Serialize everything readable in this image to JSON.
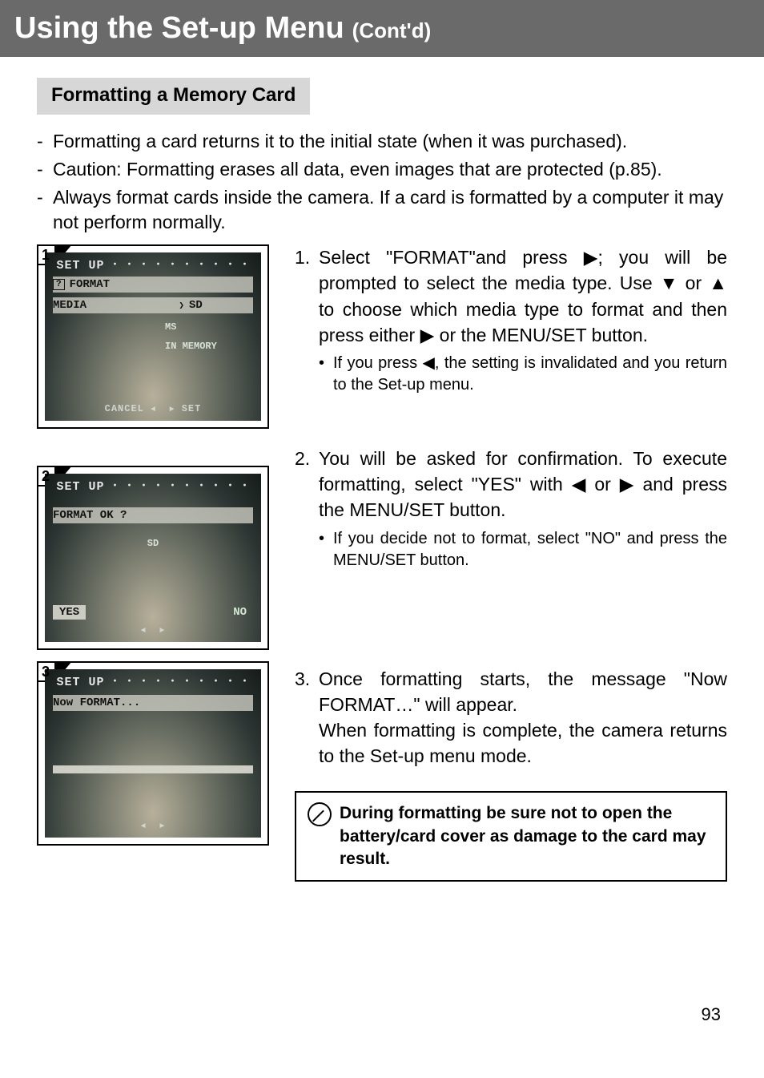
{
  "header": {
    "title": "Using the Set-up Menu",
    "subtitle": "(Cont'd)"
  },
  "section": {
    "heading": "Formatting a Memory Card"
  },
  "intro": {
    "items": [
      "Formatting a card returns it to the initial state (when it was purchased).",
      "Caution: Formatting erases all data, even images that are protected (p.85).",
      "Always format cards inside the camera.  If a card is formatted by a computer it may not perform normally."
    ]
  },
  "screenshots": {
    "s1": {
      "num": "1",
      "title": "SET UP",
      "row_format": "FORMAT",
      "row_media": "MEDIA",
      "opt_sd": "SD",
      "opt_ms": "MS",
      "opt_mem": "IN MEMORY",
      "foot_cancel": "CANCEL",
      "foot_set": "SET"
    },
    "s2": {
      "num": "2",
      "title": "SET UP",
      "row_prompt": "FORMAT OK ?",
      "opt_sd": "SD",
      "yes": "YES",
      "no": "NO"
    },
    "s3": {
      "num": "3",
      "title": "SET UP",
      "row_status": "Now FORMAT..."
    }
  },
  "steps": {
    "s1": {
      "num": "1.",
      "text_a": "Select \"FORMAT\"and press ",
      "text_b": "; you will be prompted to select the media type. Use ",
      "text_c": " or ",
      "text_d": " to choose which media type to format and then press either ",
      "text_e": " or the MENU/SET button.",
      "sub_a": "If you press ",
      "sub_b": ", the setting is invalidated and you return to the Set-up menu."
    },
    "s2": {
      "num": "2.",
      "text_a": "You will be asked for confirmation.  To execute formatting, select \"YES\" with ",
      "text_b": " or ",
      "text_c": " and press the MENU/SET button.",
      "sub": "If you decide not to format, select \"NO\" and press the MENU/SET button."
    },
    "s3": {
      "num": "3.",
      "text_a": "Once formatting starts, the message \"Now FORMAT…\" will appear.",
      "text_b": "When formatting is complete, the camera returns to the Set-up menu mode."
    }
  },
  "warning": "During formatting be sure not to open the battery/card cover as damage to the card may result.",
  "glyphs": {
    "right": "▶",
    "left": "◀",
    "up": "▲",
    "down": "▼"
  },
  "page_number": "93"
}
